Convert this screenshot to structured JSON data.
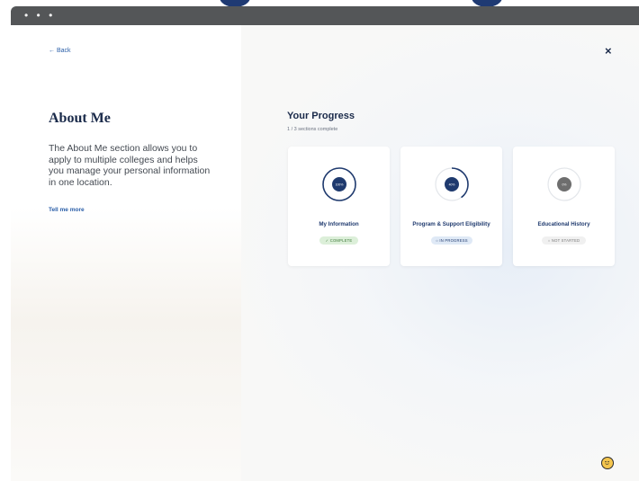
{
  "back_label": "← Back",
  "close_label": "×",
  "window_dots": "• • •",
  "about": {
    "title": "About Me",
    "description": "The About Me section allows you to apply to multiple colleges and helps you manage your personal information in one location.",
    "link": "Tell me more"
  },
  "progress": {
    "title": "Your Progress",
    "subtitle": "1 / 3 sections complete"
  },
  "cards": [
    {
      "name": "My Information",
      "percent_label": "100%",
      "percent": 1.0,
      "status": "COMPLETE",
      "status_icon": "check-icon"
    },
    {
      "name": "Program & Support Eligibility",
      "percent_label": "40%",
      "percent": 0.4,
      "status": "IN PROGRESS",
      "status_icon": "circle-icon"
    },
    {
      "name": "Educational History",
      "percent_label": "0%",
      "percent": 0.0,
      "status": "NOT STARTED",
      "status_icon": "circle-icon"
    }
  ],
  "colors": {
    "navy": "#1f3a6e",
    "link": "#2a5ea8",
    "complete_bg": "#dcefd9",
    "complete_text": "#3f7a3a",
    "progress_bg": "#dfe9f6",
    "progress_text": "#1f3a6e",
    "notstarted_bg": "#f0f0f0",
    "notstarted_text": "#7a7a7a",
    "gray_center": "#6e6e6e"
  }
}
